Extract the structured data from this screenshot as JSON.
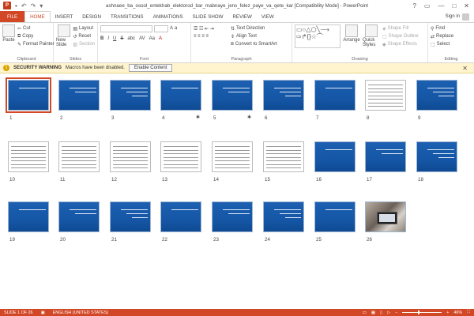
{
  "window": {
    "title": "ashnaee_ba_osool_entekhab_elektorod_bar_mabnaye_jens_felez_paye_va_qete_kar [Compatibility Mode] - PowerPoint",
    "app_icon": "P",
    "controls": [
      "?",
      "▭",
      "—",
      "□",
      "✕"
    ]
  },
  "qat": {
    "save_icon": "save-icon",
    "undo_icon": "undo-icon",
    "redo_icon": "redo-icon",
    "custom_icon": "customize-icon"
  },
  "tabs": [
    "FILE",
    "HOME",
    "INSERT",
    "DESIGN",
    "TRANSITIONS",
    "ANIMATIONS",
    "SLIDE SHOW",
    "REVIEW",
    "VIEW"
  ],
  "active_tab": "HOME",
  "signin": "Sign in",
  "ribbon": {
    "clipboard": {
      "label": "Clipboard",
      "paste": "Paste",
      "cut": "Cut",
      "copy": "Copy",
      "format_painter": "Format Painter"
    },
    "slides": {
      "label": "Slides",
      "new_slide": "New Slide",
      "layout": "Layout",
      "reset": "Reset",
      "section": "Section"
    },
    "font": {
      "label": "Font",
      "bold": "B",
      "italic": "I",
      "underline": "U",
      "strike": "S",
      "shadow": "abc",
      "spacing": "AV",
      "case": "Aa",
      "color": "A"
    },
    "paragraph": {
      "label": "Paragraph",
      "text_direction": "Text Direction",
      "align_text": "Align Text",
      "convert": "Convert to SmartArt"
    },
    "drawing": {
      "label": "Drawing",
      "arrange": "Arrange",
      "quick_styles": "Quick Styles",
      "shape_fill": "Shape Fill",
      "shape_outline": "Shape Outline",
      "shape_effects": "Shape Effects"
    },
    "editing": {
      "label": "Editing",
      "find": "Find",
      "replace": "Replace",
      "select": "Select"
    }
  },
  "security": {
    "title": "SECURITY WARNING",
    "message": "Macros have been disabled.",
    "button": "Enable Content",
    "close": "✕"
  },
  "slides": [
    {
      "n": "1",
      "type": "blue",
      "selected": true
    },
    {
      "n": "2",
      "type": "blue"
    },
    {
      "n": "3",
      "type": "blue"
    },
    {
      "n": "4",
      "type": "blue",
      "star": true
    },
    {
      "n": "5",
      "type": "blue",
      "star": true
    },
    {
      "n": "6",
      "type": "blue"
    },
    {
      "n": "7",
      "type": "blue"
    },
    {
      "n": "8",
      "type": "table"
    },
    {
      "n": "9",
      "type": "blue"
    },
    {
      "n": "10",
      "type": "table"
    },
    {
      "n": "11",
      "type": "table"
    },
    {
      "n": "12",
      "type": "table"
    },
    {
      "n": "13",
      "type": "table"
    },
    {
      "n": "14",
      "type": "table"
    },
    {
      "n": "15",
      "type": "table"
    },
    {
      "n": "16",
      "type": "blue"
    },
    {
      "n": "17",
      "type": "blue"
    },
    {
      "n": "18",
      "type": "blue"
    },
    {
      "n": "19",
      "type": "blue"
    },
    {
      "n": "20",
      "type": "blue"
    },
    {
      "n": "21",
      "type": "blue"
    },
    {
      "n": "22",
      "type": "blue"
    },
    {
      "n": "23",
      "type": "blue"
    },
    {
      "n": "24",
      "type": "blue"
    },
    {
      "n": "25",
      "type": "blue"
    },
    {
      "n": "26",
      "type": "photo"
    }
  ],
  "status": {
    "slide": "SLIDE 1 OF 26",
    "lang": "ENGLISH (UNITED STATES)",
    "zoom": "46%"
  },
  "colors": {
    "accent": "#d24726",
    "slide_blue": "#1557a6",
    "warning": "#fff4ce"
  }
}
